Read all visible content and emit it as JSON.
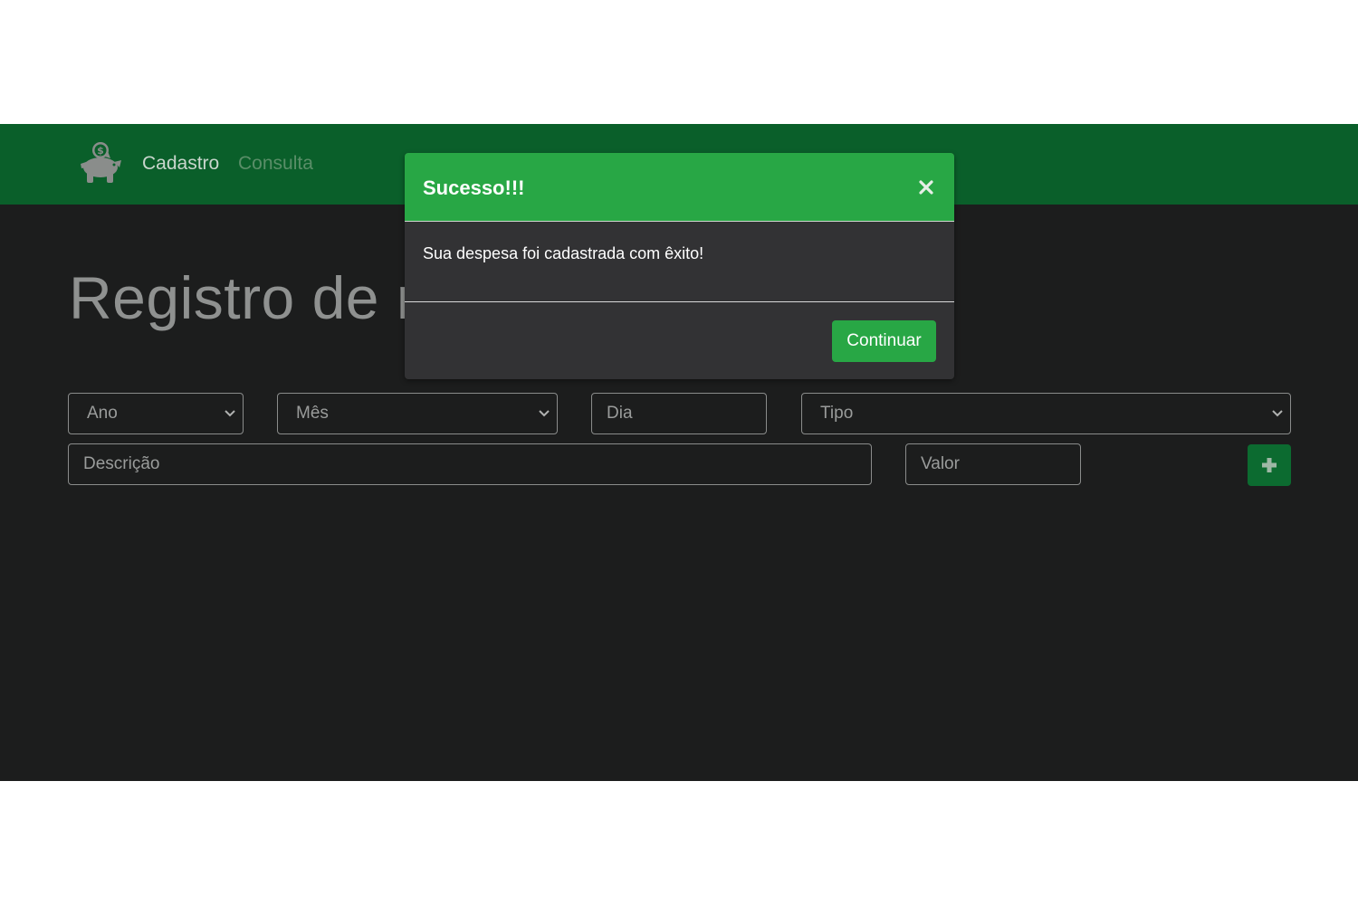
{
  "navbar": {
    "brand_icon": "piggy-bank-icon",
    "links": [
      "Cadastro",
      "Consulta"
    ],
    "color": "#0a5f2a"
  },
  "page": {
    "heading": "Registro de n"
  },
  "form": {
    "ano_placeholder": "Ano",
    "mes_placeholder": "Mês",
    "dia_placeholder": "Dia",
    "tipo_placeholder": "Tipo",
    "descricao_placeholder": "Descrição",
    "valor_placeholder": "Valor",
    "add_icon": "plus-icon"
  },
  "modal": {
    "title": "Sucesso!!!",
    "close_icon": "close-icon",
    "message": "Sua despesa foi cadastrada com êxito!",
    "button": "Continuar",
    "accent": "#28a745"
  }
}
